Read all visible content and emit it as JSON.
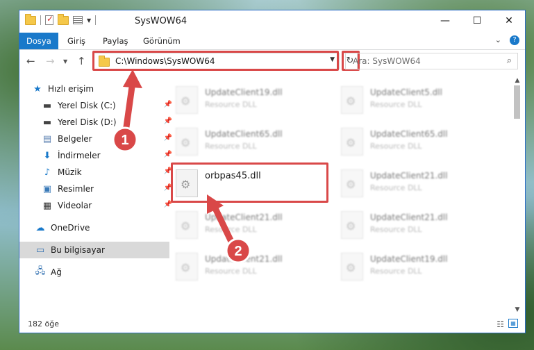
{
  "window": {
    "title": "SysWOW64",
    "minimize": "—",
    "maximize": "☐",
    "close": "✕"
  },
  "ribbon": {
    "tabs": [
      {
        "label": "Dosya",
        "active": true
      },
      {
        "label": "Giriş",
        "active": false
      },
      {
        "label": "Paylaş",
        "active": false
      },
      {
        "label": "Görünüm",
        "active": false
      }
    ],
    "help": "?"
  },
  "nav": {
    "address": "C:\\Windows\\SysWOW64",
    "search_placeholder": "Ara: SysWOW64"
  },
  "sidebar": {
    "items": [
      {
        "label": "Hızlı erişim",
        "icon": "star-icon"
      },
      {
        "label": "Yerel Disk (C:)",
        "icon": "drive-icon",
        "pinned": true
      },
      {
        "label": "Yerel Disk (D:)",
        "icon": "drive-icon",
        "pinned": true
      },
      {
        "label": "Belgeler",
        "icon": "documents-icon",
        "pinned": true
      },
      {
        "label": "İndirmeler",
        "icon": "downloads-icon",
        "pinned": true
      },
      {
        "label": "Müzik",
        "icon": "music-icon",
        "pinned": true
      },
      {
        "label": "Resimler",
        "icon": "pictures-icon",
        "pinned": true
      },
      {
        "label": "Videolar",
        "icon": "videos-icon",
        "pinned": true
      },
      {
        "label": "OneDrive",
        "icon": "cloud-icon"
      },
      {
        "label": "Bu bilgisayar",
        "icon": "computer-icon",
        "selected": true
      },
      {
        "label": "Ağ",
        "icon": "network-icon"
      }
    ]
  },
  "files": [
    {
      "name": "UpdateClient19.dll",
      "desc": "Resource DLL"
    },
    {
      "name": "UpdateClient5.dll",
      "desc": "Resource DLL"
    },
    {
      "name": "UpdateClient65.dll",
      "desc": "Resource DLL"
    },
    {
      "name": "UpdateClient65.dll",
      "desc": "Resource DLL"
    },
    {
      "name": "orbpas45.dll",
      "desc": ""
    },
    {
      "name": "UpdateClient21.dll",
      "desc": "Resource DLL"
    },
    {
      "name": "UpdateClient21.dll",
      "desc": "Resource DLL"
    },
    {
      "name": "UpdateClient21.dll",
      "desc": "Resource DLL"
    },
    {
      "name": "UpdateClient21.dll",
      "desc": "Resource DLL"
    },
    {
      "name": "UpdateClient19.dll",
      "desc": "Resource DLL"
    }
  ],
  "status": {
    "count": "182 öğe"
  },
  "annotations": {
    "step1": "1",
    "step2": "2",
    "color": "#d94848"
  }
}
